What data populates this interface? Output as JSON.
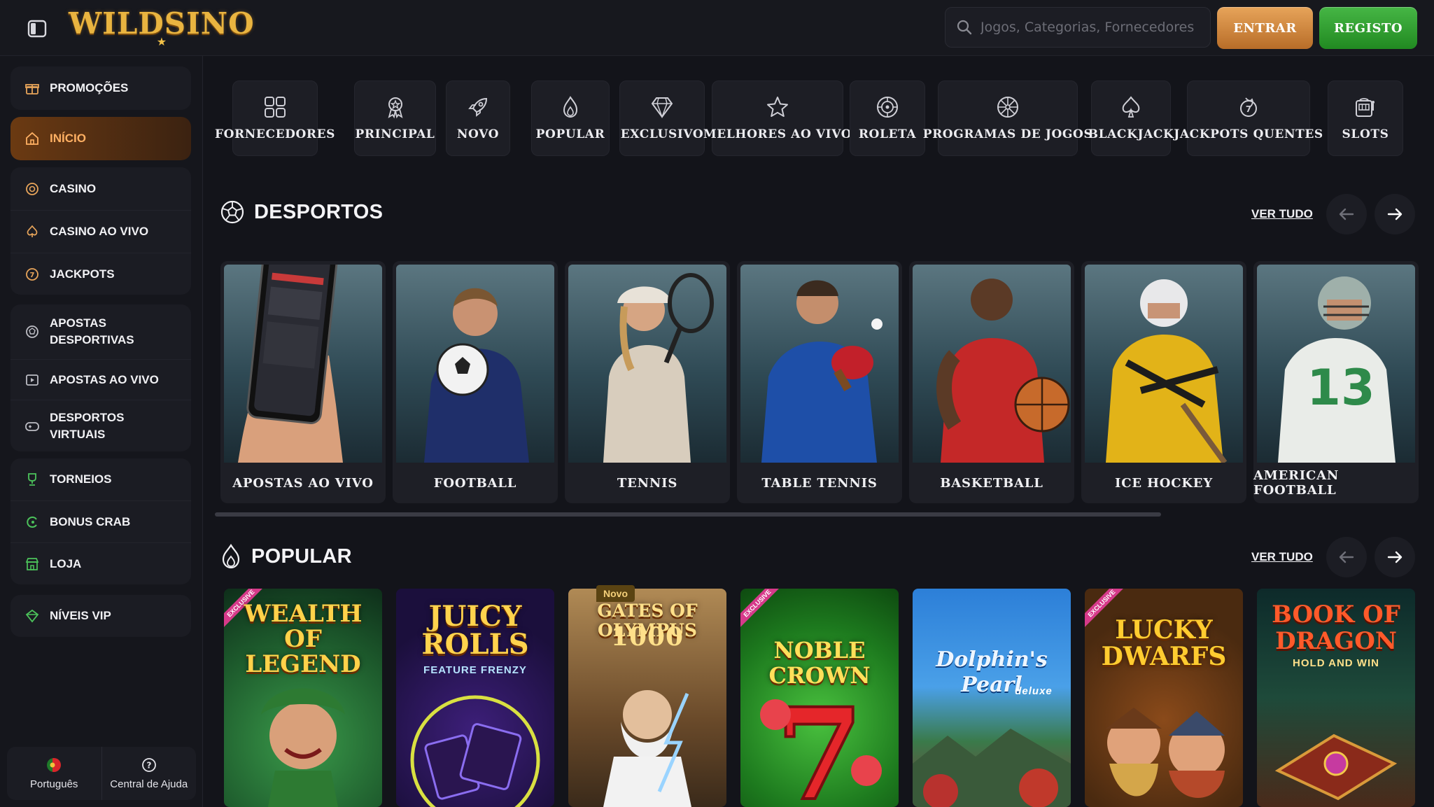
{
  "brand": {
    "logo_text": "WILDSINO"
  },
  "search": {
    "placeholder": "Jogos, Categorias, Fornecedores"
  },
  "auth": {
    "login_label": "ENTRAR",
    "register_label": "REGISTO"
  },
  "sidebar": {
    "groups": [
      [
        {
          "label": "PROMOÇÕES",
          "icon": "gift-icon"
        }
      ],
      [
        {
          "label": "INÍCIO",
          "icon": "home-icon",
          "active": true
        }
      ],
      [
        {
          "label": "CASINO",
          "icon": "chip-icon"
        },
        {
          "label": "CASINO AO VIVO",
          "icon": "spade-icon"
        },
        {
          "label": "JACKPOTS",
          "icon": "jackpot-icon"
        }
      ],
      [
        {
          "label": "APOSTAS DESPORTIVAS",
          "icon": "ball-icon"
        },
        {
          "label": "APOSTAS AO VIVO",
          "icon": "live-icon"
        },
        {
          "label": "DESPORTOS VIRTUAIS",
          "icon": "gamepad-icon"
        }
      ],
      [
        {
          "label": "TORNEIOS",
          "icon": "trophy-icon"
        },
        {
          "label": "BONUS CRAB",
          "icon": "crab-icon"
        },
        {
          "label": "LOJA",
          "icon": "shop-icon"
        }
      ],
      [
        {
          "label": "NÍVEIS VIP",
          "icon": "vip-icon"
        }
      ]
    ],
    "footer": {
      "language": "Português",
      "help": "Central de Ajuda"
    }
  },
  "categories": [
    {
      "label": "FORNECEDORES",
      "icon": "grid-icon"
    },
    {
      "label": "PRINCIPAL",
      "icon": "medal-icon"
    },
    {
      "label": "NOVO",
      "icon": "rocket-icon"
    },
    {
      "label": "POPULAR",
      "icon": "flame-icon"
    },
    {
      "label": "EXCLUSIVO",
      "icon": "diamond-icon"
    },
    {
      "label": "MELHORES AO VIVO",
      "icon": "star-icon"
    },
    {
      "label": "ROLETA",
      "icon": "roulette-icon"
    },
    {
      "label": "PROGRAMAS DE JOGOS",
      "icon": "wheel-icon"
    },
    {
      "label": "BLACKJACK",
      "icon": "spade-icon"
    },
    {
      "label": "JACKPOTS QUENTES",
      "icon": "hot-jackpot-icon"
    },
    {
      "label": "SLOTS",
      "icon": "slot-machine-icon"
    }
  ],
  "sports_section": {
    "title": "DESPORTOS",
    "see_all": "VER TUDO",
    "items": [
      "APOSTAS AO VIVO",
      "FOOTBALL",
      "TENNIS",
      "TABLE TENNIS",
      "BASKETBALL",
      "ICE HOCKEY",
      "AMERICAN FOOTBALL"
    ]
  },
  "popular_section": {
    "title": "POPULAR",
    "see_all": "VER TUDO",
    "new_badge": "Novo",
    "games": [
      {
        "title": "WEALTH OF LEGEND",
        "ribbon": "EXCLUSIVE"
      },
      {
        "title": "JUICY ROLLS",
        "subtitle": "FEATURE FRENZY"
      },
      {
        "title": "GATES OF OLYMPUS",
        "subtitle": "1000"
      },
      {
        "title": "NOBLE CROWN",
        "ribbon": "EXCLUSIVE"
      },
      {
        "title": "Dolphin's Pearl",
        "subtitle": "deluxe"
      },
      {
        "title": "LUCKY DWARFS",
        "ribbon": "EXCLUSIVE"
      },
      {
        "title": "BOOK OF DRAGON",
        "subtitle": "HOLD AND WIN"
      }
    ]
  },
  "colors": {
    "accent_orange": "#e7a45a",
    "accent_green": "#46b645",
    "background": "#13141a"
  }
}
